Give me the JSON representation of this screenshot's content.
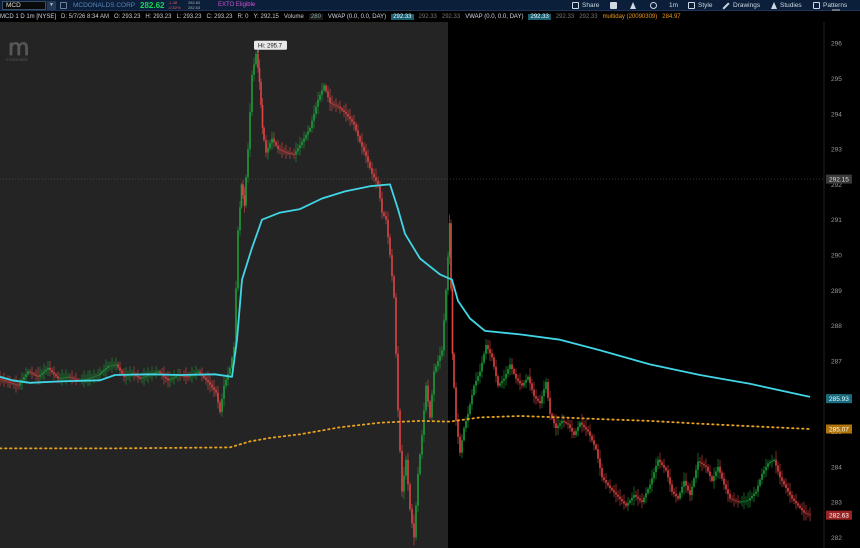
{
  "toolbar": {
    "symbol": "MCD",
    "company": "MCDONALDS CORP",
    "last_price": "282.62",
    "mini_quote": {
      "r1": "-1.48",
      "r2": "-0.52%",
      "r3": "282.60",
      "r4": "282.63"
    },
    "exto": "EXTO Eligible",
    "share": "Share",
    "timeframe": "1m",
    "style": "Style",
    "drawings": "Drawings",
    "studies": "Studies",
    "patterns": "Patterns"
  },
  "infobar": {
    "title": "MCD 1 D 1m [NYSE]",
    "date": "D: 5/7/26 8:34 AM",
    "open": "O: 293.23",
    "high": "H: 293.23",
    "low": "L: 293.23",
    "close": "C: 293.23",
    "range": "R: 0",
    "y": "Y: 292.15",
    "volume_label": "Volume",
    "volume_value": "280",
    "vwap1_label": "VWAP (0.0, 0.0, DAY)",
    "vwap1_val": "292.33",
    "vwap1_g1": "292.33",
    "vwap1_g2": "292.33",
    "vwap2_label": "VWAP (0.0, 0.0, DAY)",
    "vwap2_val": "292.33",
    "vwap2_g1": "292.33",
    "vwap2_g2": "292.33",
    "multiday_label": "multiday (20090309)",
    "multiday_val": "284.97"
  },
  "logo_caption": "mcdonalds",
  "colors": {
    "up": "#1e9e3a",
    "down": "#e04545",
    "vwap": "#41d6e6",
    "multiday": "#e8a21f",
    "premarket_bg": "#242424",
    "session_bg": "#000000",
    "axis_bg": "#000000"
  },
  "chart_data": {
    "type": "line",
    "symbol": "MCD",
    "interval": "1m",
    "ylim": [
      281.7,
      296.6
    ],
    "y_ticks": [
      282,
      283,
      284,
      285,
      286,
      287,
      288,
      289,
      290,
      291,
      292,
      293,
      294,
      295,
      296
    ],
    "crosshair_y": 292.15,
    "high_annotation": "Hi: 295.7",
    "high_value": 295.7,
    "price_badges": [
      {
        "value": "292.15",
        "role": "crosshair"
      },
      {
        "value": "285.93",
        "role": "vwap"
      },
      {
        "value": "285.07",
        "role": "multiday"
      },
      {
        "value": "282.63",
        "role": "last"
      }
    ],
    "series": [
      {
        "name": "VWAP (0.0, 0.0, DAY)",
        "values": [
          [
            0,
            286.55
          ],
          [
            12,
            286.45
          ],
          [
            30,
            286.38
          ],
          [
            60,
            286.42
          ],
          [
            100,
            286.45
          ],
          [
            115,
            286.6
          ],
          [
            150,
            286.62
          ],
          [
            180,
            286.6
          ],
          [
            215,
            286.62
          ],
          [
            232,
            286.55
          ],
          [
            237,
            287.6
          ],
          [
            242,
            289.3
          ],
          [
            252,
            290.2
          ],
          [
            262,
            291.0
          ],
          [
            280,
            291.2
          ],
          [
            300,
            291.3
          ],
          [
            322,
            291.6
          ],
          [
            345,
            291.8
          ],
          [
            370,
            291.95
          ],
          [
            390,
            292.0
          ],
          [
            398,
            291.3
          ],
          [
            405,
            290.6
          ],
          [
            420,
            289.9
          ],
          [
            440,
            289.45
          ],
          [
            452,
            289.3
          ],
          [
            458,
            288.7
          ],
          [
            470,
            288.2
          ],
          [
            485,
            287.85
          ],
          [
            520,
            287.75
          ],
          [
            560,
            287.6
          ],
          [
            600,
            287.3
          ],
          [
            650,
            286.9
          ],
          [
            700,
            286.6
          ],
          [
            750,
            286.35
          ],
          [
            810,
            285.98
          ]
        ]
      },
      {
        "name": "multiday (20090309)",
        "values": [
          [
            0,
            284.52
          ],
          [
            110,
            284.52
          ],
          [
            230,
            284.55
          ],
          [
            250,
            284.72
          ],
          [
            270,
            284.82
          ],
          [
            300,
            284.92
          ],
          [
            340,
            285.12
          ],
          [
            380,
            285.25
          ],
          [
            420,
            285.3
          ],
          [
            450,
            285.28
          ],
          [
            480,
            285.4
          ],
          [
            520,
            285.44
          ],
          [
            560,
            285.4
          ],
          [
            600,
            285.35
          ],
          [
            650,
            285.3
          ],
          [
            700,
            285.22
          ],
          [
            750,
            285.15
          ],
          [
            810,
            285.07
          ]
        ]
      },
      {
        "name": "price",
        "values": [
          [
            0,
            286.5
          ],
          [
            10,
            286.4
          ],
          [
            20,
            286.3
          ],
          [
            30,
            286.7
          ],
          [
            40,
            286.55
          ],
          [
            50,
            286.8
          ],
          [
            60,
            286.5
          ],
          [
            70,
            286.55
          ],
          [
            80,
            286.45
          ],
          [
            90,
            286.5
          ],
          [
            100,
            286.6
          ],
          [
            110,
            286.85
          ],
          [
            118,
            286.9
          ],
          [
            126,
            286.55
          ],
          [
            134,
            286.65
          ],
          [
            142,
            286.5
          ],
          [
            150,
            286.6
          ],
          [
            160,
            286.7
          ],
          [
            170,
            286.45
          ],
          [
            180,
            286.6
          ],
          [
            190,
            286.55
          ],
          [
            200,
            286.7
          ],
          [
            210,
            286.4
          ],
          [
            218,
            286.1
          ],
          [
            222,
            285.55
          ],
          [
            226,
            286.3
          ],
          [
            232,
            286.8
          ],
          [
            236,
            287.4
          ],
          [
            240,
            290.7
          ],
          [
            243,
            292.0
          ],
          [
            246,
            291.4
          ],
          [
            250,
            293.0
          ],
          [
            254,
            295.1
          ],
          [
            258,
            295.7
          ],
          [
            261,
            294.9
          ],
          [
            264,
            293.6
          ],
          [
            268,
            292.9
          ],
          [
            274,
            293.3
          ],
          [
            280,
            293.0
          ],
          [
            288,
            292.9
          ],
          [
            296,
            292.85
          ],
          [
            304,
            293.2
          ],
          [
            312,
            293.6
          ],
          [
            320,
            294.4
          ],
          [
            326,
            294.8
          ],
          [
            332,
            294.3
          ],
          [
            340,
            294.2
          ],
          [
            348,
            294.0
          ],
          [
            356,
            293.7
          ],
          [
            362,
            293.2
          ],
          [
            368,
            292.8
          ],
          [
            374,
            292.3
          ],
          [
            380,
            292.0
          ],
          [
            384,
            291.2
          ],
          [
            388,
            291.0
          ],
          [
            392,
            290.0
          ],
          [
            396,
            288.8
          ],
          [
            400,
            285.6
          ],
          [
            404,
            283.3
          ],
          [
            408,
            284.2
          ],
          [
            412,
            282.8
          ],
          [
            416,
            282.0
          ],
          [
            420,
            283.8
          ],
          [
            424,
            284.9
          ],
          [
            428,
            286.3
          ],
          [
            432,
            285.4
          ],
          [
            436,
            286.7
          ],
          [
            440,
            287.0
          ],
          [
            444,
            287.3
          ],
          [
            448,
            289.0
          ],
          [
            451,
            290.9
          ],
          [
            454,
            287.2
          ],
          [
            458,
            285.3
          ],
          [
            462,
            284.4
          ],
          [
            466,
            285.1
          ],
          [
            470,
            285.5
          ],
          [
            476,
            286.3
          ],
          [
            482,
            286.7
          ],
          [
            488,
            287.45
          ],
          [
            494,
            287.1
          ],
          [
            500,
            286.3
          ],
          [
            506,
            286.5
          ],
          [
            512,
            286.9
          ],
          [
            518,
            286.5
          ],
          [
            524,
            286.3
          ],
          [
            530,
            286.55
          ],
          [
            536,
            286.0
          ],
          [
            542,
            285.8
          ],
          [
            548,
            286.4
          ],
          [
            552,
            285.5
          ],
          [
            558,
            285.1
          ],
          [
            564,
            285.3
          ],
          [
            570,
            285.2
          ],
          [
            576,
            284.9
          ],
          [
            582,
            285.25
          ],
          [
            590,
            285.0
          ],
          [
            598,
            284.5
          ],
          [
            604,
            283.7
          ],
          [
            612,
            283.4
          ],
          [
            620,
            283.15
          ],
          [
            628,
            282.9
          ],
          [
            636,
            283.2
          ],
          [
            644,
            283.0
          ],
          [
            652,
            283.5
          ],
          [
            660,
            284.2
          ],
          [
            668,
            283.9
          ],
          [
            674,
            283.3
          ],
          [
            680,
            283.1
          ],
          [
            686,
            283.6
          ],
          [
            692,
            283.2
          ],
          [
            700,
            284.15
          ],
          [
            708,
            284.0
          ],
          [
            714,
            283.6
          ],
          [
            720,
            284.0
          ],
          [
            726,
            283.5
          ],
          [
            732,
            283.1
          ],
          [
            740,
            283.0
          ],
          [
            750,
            283.05
          ],
          [
            758,
            283.3
          ],
          [
            764,
            283.8
          ],
          [
            770,
            284.1
          ],
          [
            776,
            284.2
          ],
          [
            782,
            283.7
          ],
          [
            788,
            283.4
          ],
          [
            794,
            283.1
          ],
          [
            800,
            282.9
          ],
          [
            806,
            282.7
          ],
          [
            812,
            282.63
          ]
        ]
      }
    ]
  }
}
